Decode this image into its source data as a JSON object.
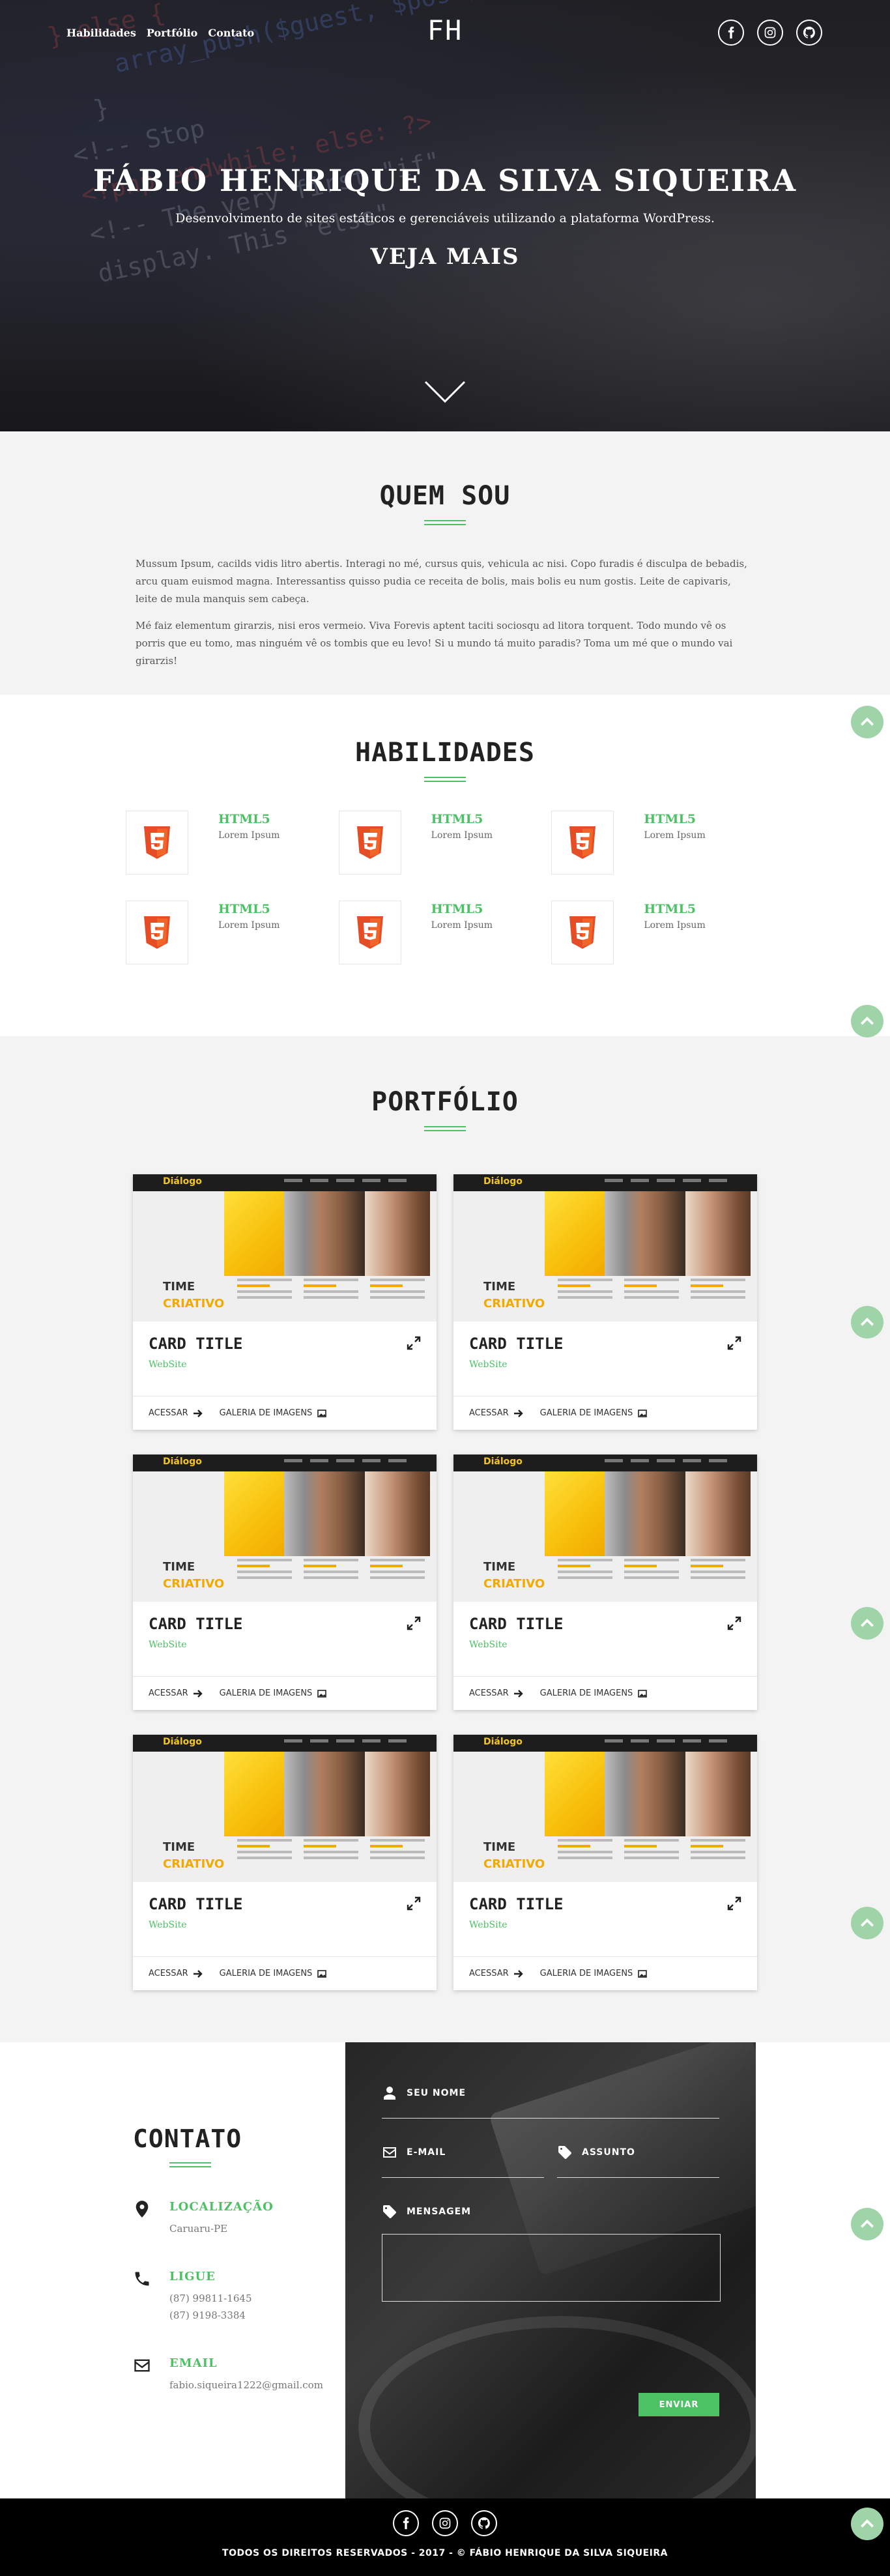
{
  "nav": {
    "links": [
      "Habilidades",
      "Portfólio",
      "Contato"
    ],
    "logo": "FH"
  },
  "social": [
    "facebook-icon",
    "instagram-icon",
    "github-icon"
  ],
  "hero": {
    "title": "FÁBIO HENRIQUE DA SILVA SIQUEIRA",
    "subtitle": "Desenvolvimento de sites estáticos e gerenciáveis utilizando a plataforma WordPress.",
    "cta": "VEJA MAIS"
  },
  "about": {
    "title": "QUEM SOU",
    "paragraphs": [
      "Mussum Ipsum, cacilds vidis litro abertis. Interagi no mé, cursus quis, vehicula ac nisi. Copo furadis é disculpa de bebadis, arcu quam euismod magna. Interessantiss quisso pudia ce receita de bolis, mais bolis eu num gostis. Leite de capivaris, leite de mula manquis sem cabeça.",
      "Mé faiz elementum girarzis, nisi eros vermeio. Viva Forevis aptent taciti sociosqu ad litora torquent. Todo mundo vê os porris que eu tomo, mas ninguém vê os tombis que eu levo! Si u mundo tá muito paradis? Toma um mé que o mundo vai girarzis!"
    ]
  },
  "skills": {
    "title": "HABILIDADES",
    "items": [
      {
        "name": "HTML5",
        "desc": "Lorem Ipsum"
      },
      {
        "name": "HTML5",
        "desc": "Lorem Ipsum"
      },
      {
        "name": "HTML5",
        "desc": "Lorem Ipsum"
      },
      {
        "name": "HTML5",
        "desc": "Lorem Ipsum"
      },
      {
        "name": "HTML5",
        "desc": "Lorem Ipsum"
      },
      {
        "name": "HTML5",
        "desc": "Lorem Ipsum"
      }
    ]
  },
  "portfolio": {
    "title": "PORTFÓLIO",
    "thumb": {
      "logo": "Diálogo",
      "time": "TIME",
      "creative": "CRIATIVO"
    },
    "cards": [
      {
        "title": "CARD TITLE",
        "sub": "WebSite",
        "access": "ACESSAR",
        "gallery": "GALERIA DE IMAGENS"
      },
      {
        "title": "CARD TITLE",
        "sub": "WebSite",
        "access": "ACESSAR",
        "gallery": "GALERIA DE IMAGENS"
      },
      {
        "title": "CARD TITLE",
        "sub": "WebSite",
        "access": "ACESSAR",
        "gallery": "GALERIA DE IMAGENS"
      },
      {
        "title": "CARD TITLE",
        "sub": "WebSite",
        "access": "ACESSAR",
        "gallery": "GALERIA DE IMAGENS"
      },
      {
        "title": "CARD TITLE",
        "sub": "WebSite",
        "access": "ACESSAR",
        "gallery": "GALERIA DE IMAGENS"
      },
      {
        "title": "CARD TITLE",
        "sub": "WebSite",
        "access": "ACESSAR",
        "gallery": "GALERIA DE IMAGENS"
      }
    ]
  },
  "contact": {
    "title": "CONTATO",
    "location": {
      "label": "LOCALIZAÇÃO",
      "value": "Caruaru-PE"
    },
    "phone": {
      "label": "LIGUE",
      "value1": "(87) 99811-1645",
      "value2": "(87) 9198-3384"
    },
    "email": {
      "label": "EMAIL",
      "value": "fabio.siqueira1222@gmail.com"
    },
    "form": {
      "name": "SEU NOME",
      "email": "E-MAIL",
      "subject": "ASSUNTO",
      "message": "MENSAGEM",
      "send": "ENVIAR"
    }
  },
  "footer": {
    "text": "TODOS OS DIREITOS RESERVADOS - 2017 - © FÁBIO HENRIQUE DA SILVA SIQUEIRA"
  },
  "colors": {
    "accent": "#4cc264",
    "html5": "#e44d26",
    "dark": "#1b1b1f"
  }
}
